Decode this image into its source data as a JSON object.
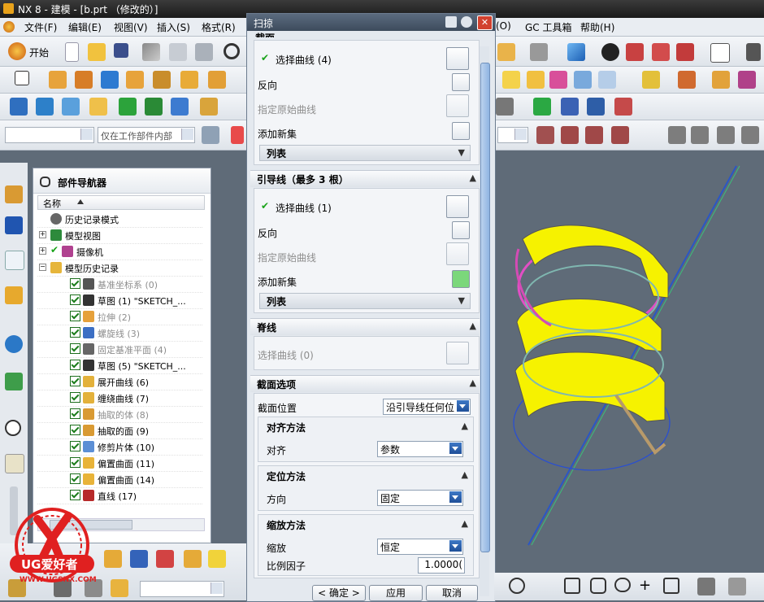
{
  "window": {
    "title": "NX 8 - 建模 - [b.prt （修改的）]"
  },
  "menu": {
    "items": [
      "文件(F)",
      "编辑(E)",
      "视图(V)",
      "插入(S)",
      "格式(R)"
    ],
    "right_items": [
      "(O)",
      "GC 工具箱",
      "帮助(H)"
    ]
  },
  "toolbar": {
    "start_label": "开始",
    "filter_combo": "",
    "scope_combo": "仅在工作部件内部"
  },
  "navigator": {
    "title": "部件导航器",
    "column_header": "名称",
    "rows": [
      {
        "label": "历史记录模式",
        "type": "history",
        "disabled": false,
        "indent": 1
      },
      {
        "label": "模型视图",
        "type": "views",
        "disabled": false,
        "indent": 1
      },
      {
        "label": "摄像机",
        "type": "camera",
        "disabled": false,
        "indent": 1
      },
      {
        "label": "模型历史记录",
        "type": "folder",
        "disabled": false,
        "indent": 1
      },
      {
        "label": "基准坐标系 (0)",
        "type": "csys",
        "disabled": true,
        "indent": 2
      },
      {
        "label": "草图 (1) \"SKETCH_...",
        "type": "sketch",
        "disabled": false,
        "indent": 2
      },
      {
        "label": "拉伸 (2)",
        "type": "extrude",
        "disabled": true,
        "indent": 2
      },
      {
        "label": "螺旋线 (3)",
        "type": "helix",
        "disabled": true,
        "indent": 2
      },
      {
        "label": "固定基准平面 (4)",
        "type": "plane",
        "disabled": true,
        "indent": 2
      },
      {
        "label": "草图 (5) \"SKETCH_...",
        "type": "sketch",
        "disabled": false,
        "indent": 2
      },
      {
        "label": "展开曲线 (6)",
        "type": "unwrap",
        "disabled": false,
        "indent": 2
      },
      {
        "label": "缠绕曲线 (7)",
        "type": "wrap",
        "disabled": false,
        "indent": 2
      },
      {
        "label": "抽取的体 (8)",
        "type": "extract",
        "disabled": true,
        "indent": 2
      },
      {
        "label": "抽取的面 (9)",
        "type": "extract",
        "disabled": false,
        "indent": 2
      },
      {
        "label": "修剪片体 (10)",
        "type": "trim",
        "disabled": false,
        "indent": 2
      },
      {
        "label": "偏置曲面 (11)",
        "type": "offset",
        "disabled": false,
        "indent": 2
      },
      {
        "label": "偏置曲面 (14)",
        "type": "offset",
        "disabled": false,
        "indent": 2
      },
      {
        "label": "直线 (17)",
        "type": "line",
        "disabled": false,
        "indent": 2
      }
    ]
  },
  "dialog": {
    "title": "扫掠",
    "top_partial": "截面",
    "section1": {
      "select_label": "选择曲线 (4)",
      "reverse_label": "反向",
      "origin_label": "指定原始曲线",
      "add_set_label": "添加新集",
      "list_label": "列表"
    },
    "guides": {
      "header": "引导线（最多 3 根）",
      "select_label": "选择曲线 (1)",
      "reverse_label": "反向",
      "origin_label": "指定原始曲线",
      "add_set_label": "添加新集",
      "list_label": "列表"
    },
    "spine": {
      "header": "脊线",
      "select_label": "选择曲线 (0)"
    },
    "section_options": {
      "header": "截面选项",
      "position_label": "截面位置",
      "position_value": "沿引导线任何位",
      "align_header": "对齐方法",
      "align_label": "对齐",
      "align_value": "参数",
      "orient_header": "定位方法",
      "orient_label": "方向",
      "orient_value": "固定",
      "scale_header": "缩放方法",
      "scale_label": "缩放",
      "scale_value": "恒定",
      "factor_label": "比例因子",
      "factor_value": "1.0000("
    },
    "buttons": {
      "ok": "< 确定 >",
      "apply": "应用",
      "cancel": "取消"
    }
  },
  "watermark": {
    "brand": "UG爱好者",
    "url": "WWW.UGSNX.COM"
  },
  "colors": {
    "accent_blue": "#2d5ca6",
    "check_green": "#19a319",
    "model_yellow": "#ffff00",
    "model_magenta": "#d22fb0"
  }
}
